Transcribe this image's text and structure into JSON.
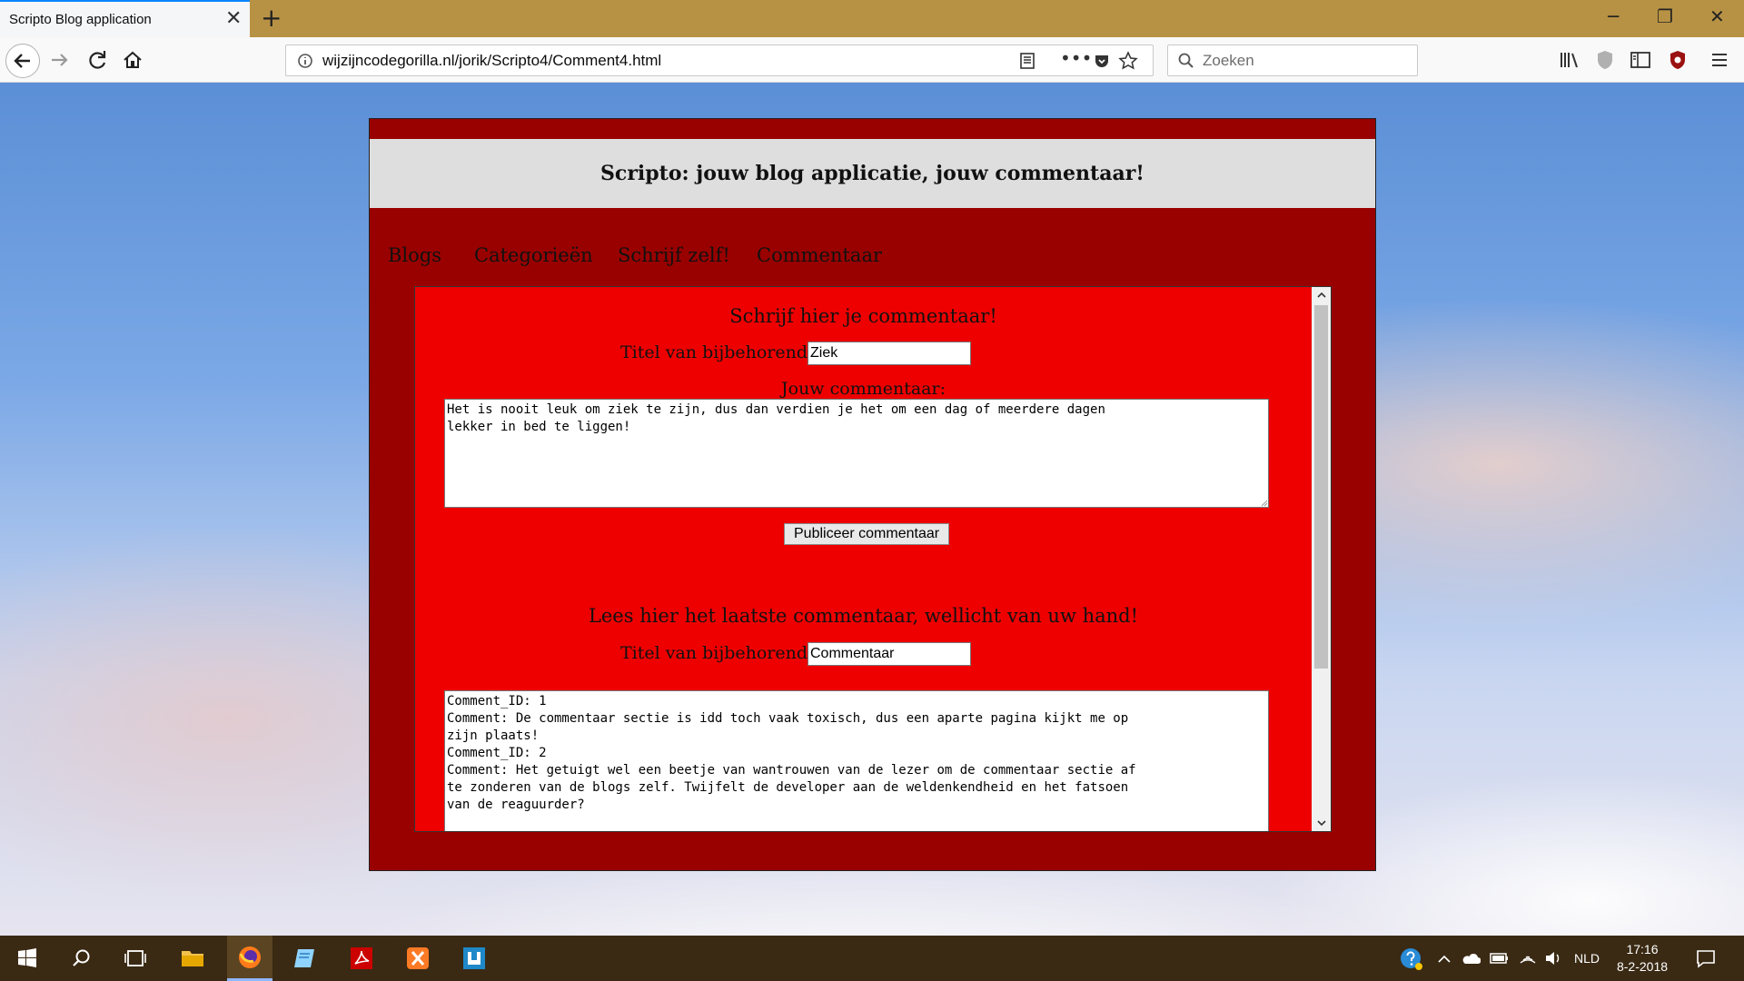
{
  "browser": {
    "tab_title": "Scripto Blog application",
    "tab_close": "✕",
    "new_tab": "+",
    "url": "wijzijncodegorilla.nl/jorik/Scripto4/Comment4.html",
    "search_placeholder": "Zoeken",
    "window_controls": {
      "minimize": "─",
      "restore": "❐",
      "close": "✕"
    }
  },
  "site": {
    "title": "Scripto: jouw blog applicatie, jouw commentaar!",
    "nav": [
      "Blogs",
      "Categorieën",
      "Schrijf zelf!",
      "Commentaar"
    ]
  },
  "write_section": {
    "heading": "Schrijf hier je commentaar!",
    "blog_title_label": "Titel van bijbehorende blog:",
    "blog_title_value": "Ziek",
    "comment_label": "Jouw commentaar:",
    "comment_value": "Het is nooit leuk om ziek te zijn, dus dan verdien je het om een dag of meerdere dagen\nlekker in bed te liggen!",
    "publish_label": "Publiceer commentaar"
  },
  "read_section": {
    "heading": "Lees hier het laatste commentaar, wellicht van uw hand!",
    "blog_title_label": "Titel van bijbehorende blog:",
    "blog_title_value": "Commentaar",
    "comments_text": "Comment_ID: 1\nComment: De commentaar sectie is idd toch vaak toxisch, dus een aparte pagina kijkt me op\nzijn plaats!\nComment_ID: 2\nComment: Het getuigt wel een beetje van wantrouwen van de lezer om de commentaar sectie af\nte zonderen van de blogs zelf. Twijfelt de developer aan de weldenkendheid en het fatsoen\nvan de reaguurder?"
  },
  "taskbar": {
    "language": "NLD",
    "time": "17:16",
    "date": "8-2-2018"
  }
}
